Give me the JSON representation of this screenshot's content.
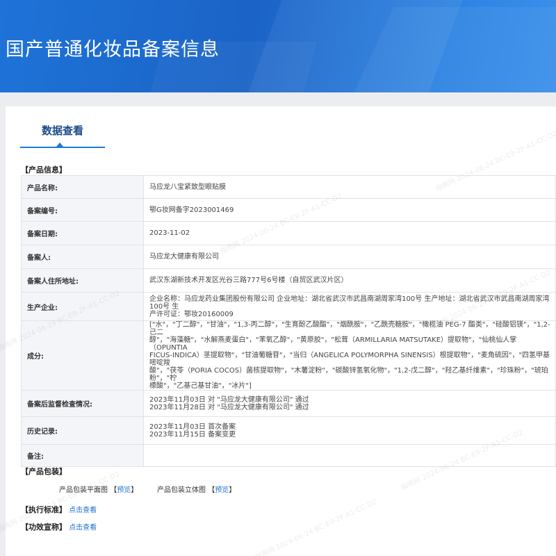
{
  "banner": {
    "title": "国产普通化妆品备案信息"
  },
  "tab": {
    "label": "数据查看"
  },
  "sections": {
    "product_info": "【产品信息】",
    "packaging": "【产品包装】",
    "standard": "【执行标准】",
    "efficacy": "【功效宣称】"
  },
  "rows": [
    {
      "label": "产品名称:",
      "value": "马应龙八宝紧致型眼贴膜"
    },
    {
      "label": "备案编号:",
      "value": "鄂G妆网备字2023001469"
    },
    {
      "label": "备案日期:",
      "value": "2023-11-02"
    },
    {
      "label": "备案人:",
      "value": "马应龙大健康有限公司"
    },
    {
      "label": "备案人住所地址:",
      "value": "武汉东湖新技术开发区光谷三路777号6号楼（自贸区武汉片区）"
    },
    {
      "label": "生产企业:",
      "lines": [
        "企业名称：马应龙药业集团股份有限公司 企业地址：湖北省武汉市武昌南湖周家湾100号 生产地址：湖北省武汉市武昌南湖周家湾100号 生",
        "产许可证：鄂妆20160009"
      ]
    },
    {
      "label": "成分:",
      "lines": [
        "[\"水\"，\"丁二醇\"，\"甘油\"，\"1,3-丙二醇\"，\"生育酚乙酸酯\"，\"烟酰胺\"，\"乙酰壳糖胺\"，\"橄榄油 PEG-7 酯类\"，\"硅酸铝镁\"，\"1,2-己二",
        "醇\"，\"海藻糖\"，\"水解燕麦蛋白\"，\"苯氧乙醇\"，\"黄原胶\"，\"松茸（ARMILLARIA MATSUTAKE）提取物\"，\"仙桃仙人掌（OPUNTIA",
        "FICUS-INDICA）茎提取物\"，\"甘油葡糖苷\"，\"当归（ANGELICA POLYMORPHA SINENSIS）根提取物\"，\"麦角硫因\"，\"四氢甲基嘧啶羧",
        "酸\"，\"茯苓（PORIA COCOS）菌核提取物\"，\"木薯淀粉\"，\"碳酸锌氢氧化物\"，\"1,2-戊二醇\"，\"羟乙基纤维素\"，\"珍珠粉\"，\"琥珀粉\"，\"柠",
        "檬酸\"，\"乙基己基甘油\"，\"冰片\"]"
      ]
    },
    {
      "label": "备案后监督检查情况:",
      "lines": [
        "2023年11月03日 对 \"马应龙大健康有限公司\" 通过",
        "2023年11月28日 对 \"马应龙大健康有限公司\" 通过"
      ]
    },
    {
      "label": "历史记录:",
      "lines": [
        "2023年11月03日 首次备案",
        "2023年11月15日 备案变更"
      ]
    },
    {
      "label": "备注:",
      "value": ""
    }
  ],
  "packaging": {
    "flat_label": "产品包装平面图",
    "flat_link": "预览",
    "stereo_label": "产品包装立体图",
    "stereo_link": "预览",
    "bracket_open": "【",
    "bracket_close": "】"
  },
  "standard": {
    "link": "点击查看"
  },
  "efficacy": {
    "link": "点击查看"
  },
  "watermark": "指南网 2024-06-24 BC-E9-2F-A1-CC-D2",
  "colors": {
    "banner": "#1e6fd6",
    "link": "#1f6fd0",
    "tab_underline": "#1f7ad6"
  }
}
